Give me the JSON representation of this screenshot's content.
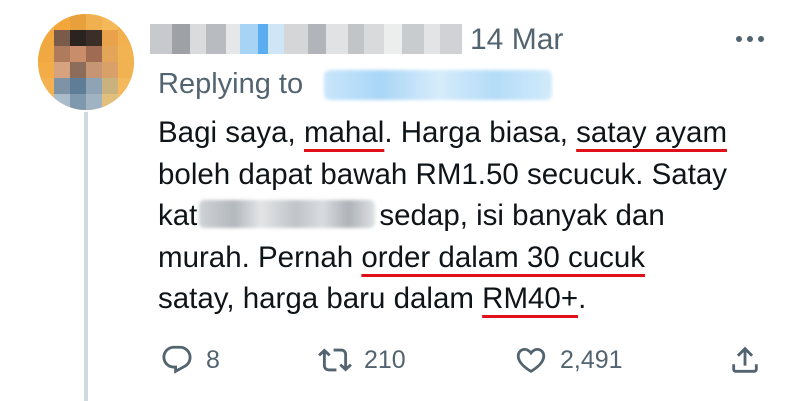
{
  "tweet": {
    "date": "14 Mar",
    "replying_label": "Replying to",
    "lines": [
      [
        "Bagi saya, ",
        "mahal",
        ". Harga biasa, ",
        "satay ayam"
      ],
      [
        "boleh dapat bawah RM1.50 secucuk. Satay"
      ],
      [
        "kat",
        "sedap, isi banyak dan"
      ],
      [
        "murah. Pernah ",
        "order dalam 30 cucuk"
      ],
      [
        "satay, harga baru dalam ",
        "RM40+",
        "."
      ]
    ],
    "actions": {
      "replies": "8",
      "retweets": "210",
      "likes": "2,491"
    },
    "icons": {
      "more": "more-horizontal-icon",
      "reply": "reply-icon",
      "retweet": "retweet-icon",
      "like": "heart-icon",
      "share": "share-icon"
    },
    "colors": {
      "text": "#0f1419",
      "secondary": "#536471",
      "underline": "#e0101b",
      "thread_line": "#cfd9de"
    }
  }
}
